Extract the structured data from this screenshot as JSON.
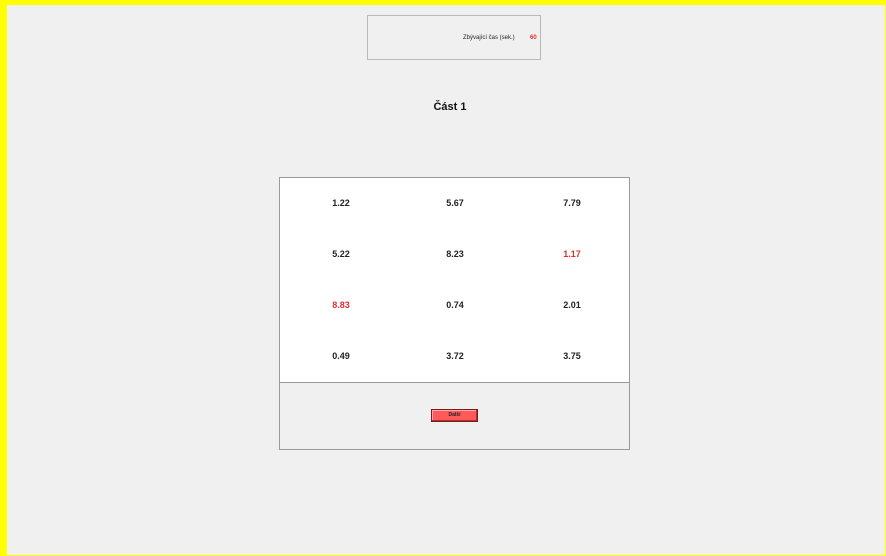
{
  "timer": {
    "label": "Zbývající čas (sek.)",
    "value": "60"
  },
  "part_title": "Část 1",
  "grid": {
    "rows": [
      [
        {
          "value": "1.22",
          "highlight": false
        },
        {
          "value": "5.67",
          "highlight": false
        },
        {
          "value": "7.79",
          "highlight": false
        }
      ],
      [
        {
          "value": "5.22",
          "highlight": false
        },
        {
          "value": "8.23",
          "highlight": false
        },
        {
          "value": "1.17",
          "highlight": true
        }
      ],
      [
        {
          "value": "8.83",
          "highlight": true
        },
        {
          "value": "0.74",
          "highlight": false
        },
        {
          "value": "2.01",
          "highlight": false
        }
      ],
      [
        {
          "value": "0.49",
          "highlight": false
        },
        {
          "value": "3.72",
          "highlight": false
        },
        {
          "value": "3.75",
          "highlight": false
        }
      ]
    ]
  },
  "next_button": {
    "label": "Další"
  },
  "colors": {
    "frame": "#ffff00",
    "background": "#f0f0f0",
    "highlight_text": "#e03030",
    "button": "#ff5a5a"
  }
}
